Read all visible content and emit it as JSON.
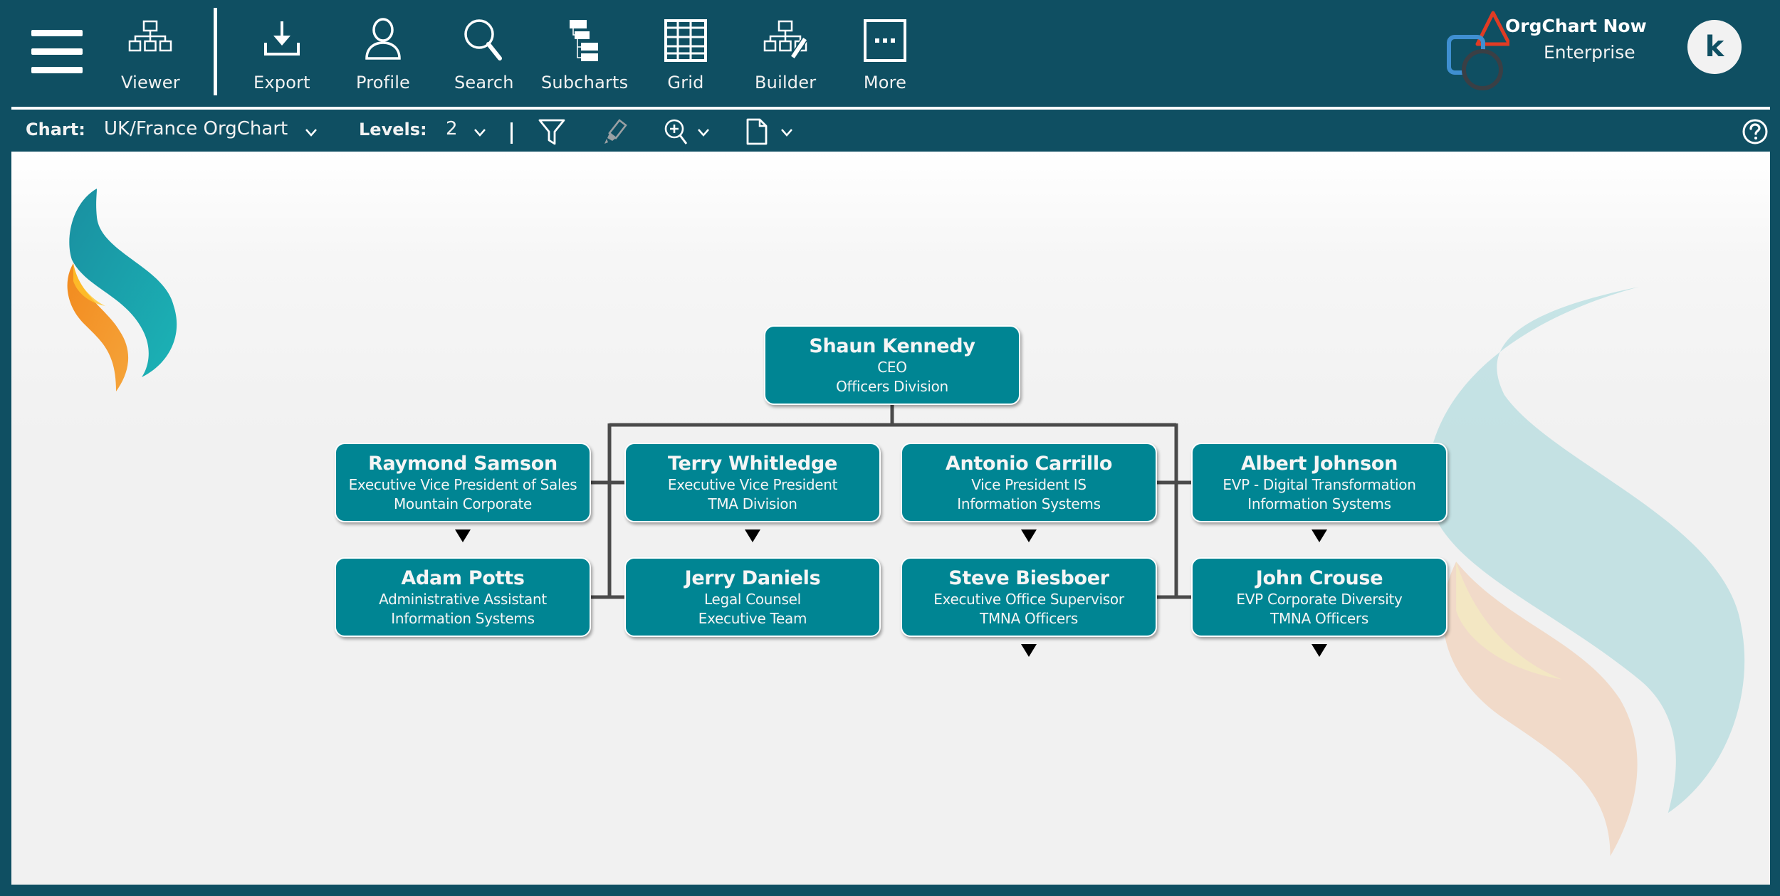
{
  "header": {
    "menu_icon": "hamburger-menu-icon",
    "buttons": [
      {
        "label": "Viewer",
        "icon": "org-viewer-icon"
      },
      {
        "label": "Export",
        "icon": "download-icon"
      },
      {
        "label": "Profile",
        "icon": "user-icon"
      },
      {
        "label": "Search",
        "icon": "search-icon"
      },
      {
        "label": "Subcharts",
        "icon": "subcharts-icon"
      },
      {
        "label": "Grid",
        "icon": "grid-icon"
      },
      {
        "label": "Builder",
        "icon": "builder-icon"
      },
      {
        "label": "More",
        "icon": "more-icon"
      }
    ],
    "brand": {
      "title": "OrgChart Now",
      "subtitle": "Enterprise"
    },
    "avatar_initial": "k",
    "colors": {
      "background": "#0f4f62",
      "text": "#f2f2f2"
    }
  },
  "toolbar": {
    "chart_label": "Chart:",
    "chart_value": "UK/France OrgChart",
    "levels_label": "Levels:",
    "levels_value": "2",
    "icons": [
      "filter-icon",
      "highlight-pen-icon",
      "zoom-in-icon",
      "document-icon",
      "help-icon"
    ]
  },
  "orgchart": {
    "node_color": "#008593",
    "root": {
      "name": "Shaun Kennedy",
      "title": "CEO",
      "dept": "Officers Division"
    },
    "columns": [
      [
        {
          "name": "Raymond Samson",
          "title": "Executive Vice President of  Sales",
          "dept": "Mountain Corporate",
          "has_children": true
        },
        {
          "name": "Adam Potts",
          "title": "Administrative Assistant",
          "dept": "Information Systems",
          "has_children": false
        }
      ],
      [
        {
          "name": "Terry Whitledge",
          "title": "Executive Vice President",
          "dept": "TMA Division",
          "has_children": true
        },
        {
          "name": "Jerry Daniels",
          "title": "Legal Counsel",
          "dept": "Executive Team",
          "has_children": false
        }
      ],
      [
        {
          "name": "Antonio Carrillo",
          "title": "Vice President IS",
          "dept": "Information Systems",
          "has_children": true
        },
        {
          "name": "Steve Biesboer",
          "title": "Executive Office Supervisor",
          "dept": "TMNA Officers",
          "has_children": true
        }
      ],
      [
        {
          "name": "Albert Johnson",
          "title": "EVP - Digital Transformation",
          "dept": "Information Systems",
          "has_children": true
        },
        {
          "name": "John Crouse",
          "title": "EVP Corporate Diversity",
          "dept": "TMNA Officers",
          "has_children": true
        }
      ]
    ]
  }
}
